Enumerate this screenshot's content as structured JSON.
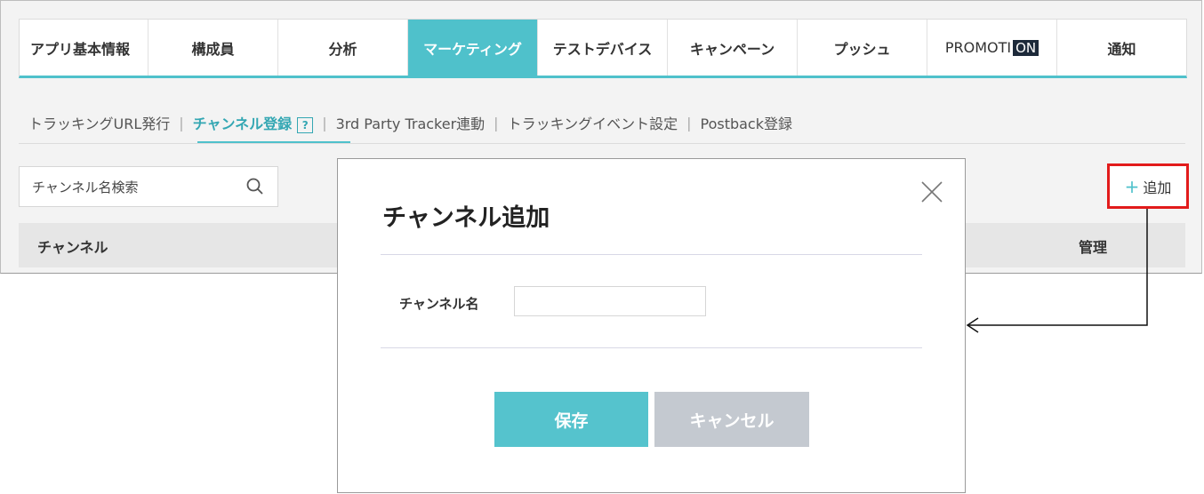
{
  "tabs": [
    {
      "label": "アプリ基本情報",
      "active": false
    },
    {
      "label": "構成員",
      "active": false
    },
    {
      "label": "分析",
      "active": false
    },
    {
      "label": "マーケティング",
      "active": true
    },
    {
      "label": "テストデバイス",
      "active": false
    },
    {
      "label": "キャンペーン",
      "active": false
    },
    {
      "label": "プッシュ",
      "active": false
    },
    {
      "label": "PROMOTI",
      "badge": "ON",
      "active": false
    },
    {
      "label": "通知",
      "active": false
    }
  ],
  "subtabs": [
    {
      "label": "トラッキングURL発行",
      "active": false
    },
    {
      "label": "チャンネル登録",
      "active": true,
      "help": "?"
    },
    {
      "label": "3rd Party Tracker連動",
      "active": false
    },
    {
      "label": "トラッキングイベント設定",
      "active": false
    },
    {
      "label": "Postback登録",
      "active": false
    }
  ],
  "search": {
    "placeholder": "チャンネル名検索",
    "icon": "search-icon"
  },
  "add_button": {
    "icon": "+",
    "label": "追加",
    "highlight_color": "#e21b1b"
  },
  "table": {
    "col_channel": "チャンネル",
    "col_manage": "管理"
  },
  "modal": {
    "title": "チャンネル追加",
    "field_label": "チャンネル名",
    "field_value": "",
    "save_label": "保存",
    "cancel_label": "キャンセル",
    "close_icon": "close-icon"
  },
  "colors": {
    "accent": "#4fc1cb",
    "save_bg": "#55c3cd",
    "cancel_bg": "#c4c9d0"
  }
}
